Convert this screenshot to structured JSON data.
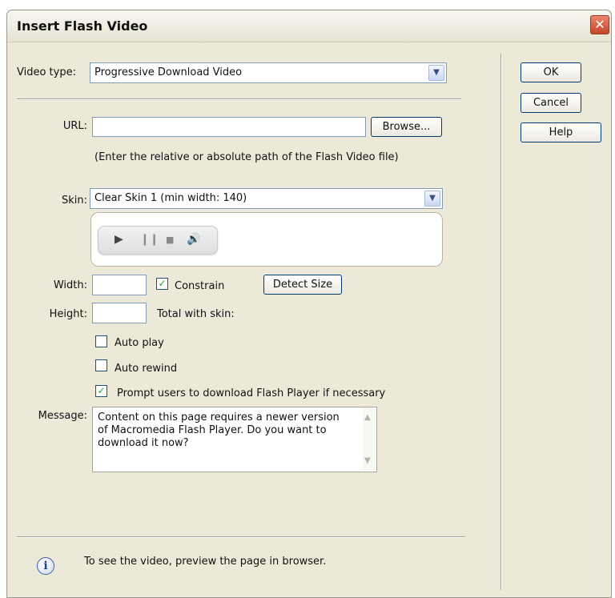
{
  "window": {
    "title": "Insert Flash Video",
    "close_glyph": "✕"
  },
  "video_type": {
    "label": "Video type:",
    "value": "Progressive Download Video"
  },
  "url": {
    "label": "URL:",
    "value": "",
    "browse_label": "Browse...",
    "hint": "(Enter the relative or absolute path of the Flash Video file)"
  },
  "skin": {
    "label": "Skin:",
    "value": "Clear Skin 1 (min width: 140)",
    "controls": [
      "play",
      "pause",
      "stop",
      "volume"
    ]
  },
  "size": {
    "width_label": "Width:",
    "width_value": "",
    "height_label": "Height:",
    "height_value": "",
    "constrain_label": "Constrain",
    "constrain_checked": true,
    "detect_size_label": "Detect Size",
    "total_label": "Total with skin:"
  },
  "options": {
    "auto_play_label": "Auto play",
    "auto_play_checked": false,
    "auto_rewind_label": "Auto rewind",
    "auto_rewind_checked": false,
    "prompt_label": "Prompt users to download Flash Player if necessary",
    "prompt_checked": true
  },
  "message": {
    "label": "Message:",
    "lines": [
      "Content on this page requires a newer version",
      "of Macromedia Flash Player. Do you want to",
      "download it now?"
    ]
  },
  "buttons": {
    "ok": "OK",
    "cancel": "Cancel",
    "help": "Help"
  },
  "footer": {
    "info": "To see the video, preview the page in browser."
  },
  "colors": {
    "dialog_bg": "#ece9d8",
    "check_green": "#21a121",
    "close_red": "#c8452b"
  }
}
